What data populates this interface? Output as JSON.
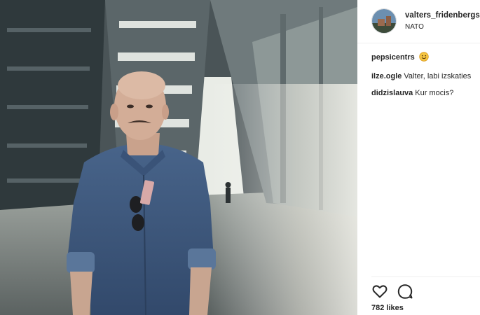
{
  "post": {
    "username": "valters_fridenbergs",
    "location": "NATO",
    "likes": "782 likes"
  },
  "comments": [
    {
      "author": "pepsicentrs",
      "text": "",
      "emoji": "smiling-face"
    },
    {
      "author": "ilze.ogle",
      "text": "Valter, labi izskaties"
    },
    {
      "author": "didzislauva",
      "text": "Kur mocis?"
    }
  ],
  "actions": {
    "like_icon": "heart-outline-icon",
    "comment_icon": "speech-bubble-icon"
  },
  "colors": {
    "text": "#262626",
    "divider": "#efefef",
    "emoji": "#f5c542",
    "shirt": "#3f5a7e"
  }
}
